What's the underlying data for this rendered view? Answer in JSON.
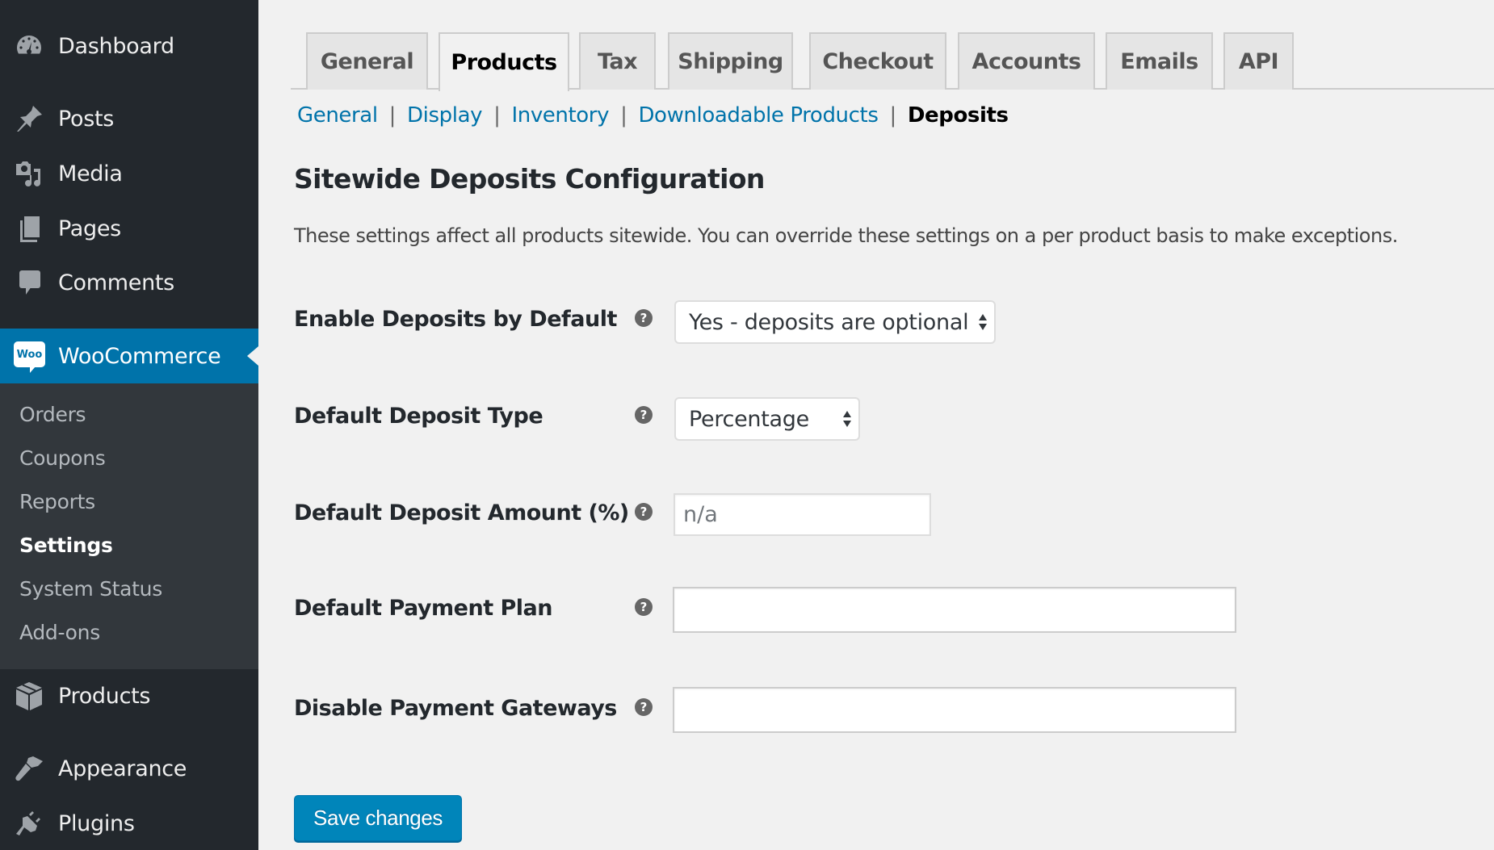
{
  "sidebar": {
    "items": [
      {
        "label": "Dashboard",
        "icon": "dashboard-icon"
      },
      {
        "label": "Posts",
        "icon": "pushpin-icon"
      },
      {
        "label": "Media",
        "icon": "media-icon"
      },
      {
        "label": "Pages",
        "icon": "pages-icon"
      },
      {
        "label": "Comments",
        "icon": "comment-icon"
      }
    ],
    "active": {
      "label": "WooCommerce",
      "icon_text": "Woo"
    },
    "submenu": [
      {
        "label": "Orders"
      },
      {
        "label": "Coupons"
      },
      {
        "label": "Reports"
      },
      {
        "label": "Settings",
        "current": true
      },
      {
        "label": "System Status"
      },
      {
        "label": "Add-ons"
      }
    ],
    "items_after": [
      {
        "label": "Products",
        "icon": "box-icon"
      },
      {
        "label": "Appearance",
        "icon": "paintbrush-icon"
      },
      {
        "label": "Plugins",
        "icon": "plug-icon"
      }
    ]
  },
  "tabs": [
    {
      "label": "General"
    },
    {
      "label": "Products",
      "active": true
    },
    {
      "label": "Tax"
    },
    {
      "label": "Shipping"
    },
    {
      "label": "Checkout"
    },
    {
      "label": "Accounts"
    },
    {
      "label": "Emails"
    },
    {
      "label": "API"
    }
  ],
  "subnav": {
    "links": [
      "General",
      "Display",
      "Inventory",
      "Downloadable Products"
    ],
    "current": "Deposits",
    "separator": "|"
  },
  "page": {
    "title": "Sitewide Deposits Configuration",
    "description": "These settings affect all products sitewide. You can override these settings on a per product basis to make exceptions."
  },
  "fields": [
    {
      "label": "Enable Deposits by Default",
      "type": "select",
      "value": "Yes - deposits are optional"
    },
    {
      "label": "Default Deposit Type",
      "type": "select",
      "value": "Percentage"
    },
    {
      "label": "Default Deposit Amount (%)",
      "type": "text",
      "value": "",
      "placeholder": "n/a"
    },
    {
      "label": "Default Payment Plan",
      "type": "multiselect",
      "value": ""
    },
    {
      "label": "Disable Payment Gateways",
      "type": "multiselect",
      "value": ""
    }
  ],
  "help_icon_glyph": "?",
  "save_button": {
    "label": "Save changes"
  },
  "colors": {
    "sidebar_bg": "#23282d",
    "submenu_bg": "#32373c",
    "accent": "#0073aa",
    "button": "#0085ba",
    "page_bg": "#f1f1f1"
  }
}
